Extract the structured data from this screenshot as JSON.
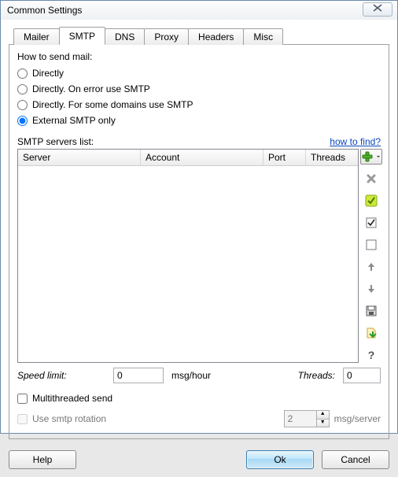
{
  "window": {
    "title": "Common Settings"
  },
  "tabs": [
    "Mailer",
    "SMTP",
    "DNS",
    "Proxy",
    "Headers",
    "Misc"
  ],
  "active_tab_index": 1,
  "send": {
    "group_label": "How to send mail:",
    "options": [
      "Directly",
      "Directly. On error use SMTP",
      "Directly. For some domains use SMTP",
      "External SMTP only"
    ],
    "selected_index": 3
  },
  "servers": {
    "label": "SMTP servers list:",
    "hint_link": "how to find?",
    "columns": [
      "Server",
      "Account",
      "Port",
      "Threads"
    ],
    "rows": []
  },
  "toolbar_icons": [
    "add",
    "delete",
    "check-all",
    "checked",
    "unchecked",
    "move-up",
    "move-down",
    "save",
    "import",
    "help"
  ],
  "speed": {
    "label": "Speed limit:",
    "value": "0",
    "unit": "msg/hour"
  },
  "threads": {
    "label": "Threads:",
    "value": "0"
  },
  "multithread": {
    "label": "Multithreaded send",
    "checked": false
  },
  "rotation": {
    "label": "Use smtp rotation",
    "checked": false,
    "enabled": false,
    "spin_value": "2",
    "spin_unit": "msg/server"
  },
  "footer": {
    "help": "Help",
    "ok": "Ok",
    "cancel": "Cancel"
  }
}
